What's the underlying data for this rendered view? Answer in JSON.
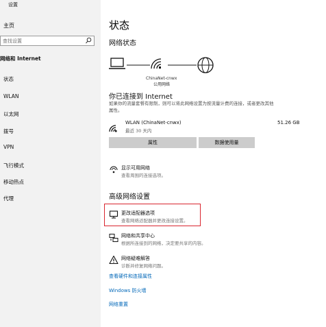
{
  "sidebar": {
    "window_title": "设置",
    "home": "主页",
    "search": {
      "placeholder": "查找设置"
    },
    "section": "网络和 Internet",
    "items": [
      {
        "label": "状态"
      },
      {
        "label": "WLAN"
      },
      {
        "label": "以太网"
      },
      {
        "label": "拨号"
      },
      {
        "label": "VPN"
      },
      {
        "label": "飞行模式"
      },
      {
        "label": "移动热点"
      },
      {
        "label": "代理"
      }
    ]
  },
  "main": {
    "title": "状态",
    "network_status": "网络状态",
    "network_name": "ChinaNet-cnwx",
    "network_type": "公用网络",
    "connected_title": "你已连接到 Internet",
    "connected_desc": "如果你的流量套餐有限制，则可以将此网络设置为按流量计费的连接，或者更改其他属性。",
    "wlan": {
      "name": "WLAN (ChinaNet-cnwx)",
      "sub": "最近 30 天内",
      "size": "51.26 GB"
    },
    "buttons": {
      "properties": "属性",
      "data_usage": "数据使用量"
    },
    "show_networks": {
      "title": "显示可用网络",
      "desc": "查看周围的连接选项。"
    },
    "advanced_title": "高级网络设置",
    "adapter": {
      "title": "更改适配器选项",
      "desc": "查看网络适配器并更改连接设置。"
    },
    "sharing": {
      "title": "网络和共享中心",
      "desc": "根据所连接到的网络，决定要共享的内容。"
    },
    "troubleshoot": {
      "title": "网络疑难解答",
      "desc": "诊断并修复网络问题。"
    },
    "links": {
      "hardware": "查看硬件和连接属性",
      "firewall": "Windows 防火墙",
      "reset": "网络重置"
    }
  },
  "colors": {
    "accent": "#0067b8",
    "highlight": "#d9232d",
    "sidebar_bg": "#f2f2f2"
  }
}
